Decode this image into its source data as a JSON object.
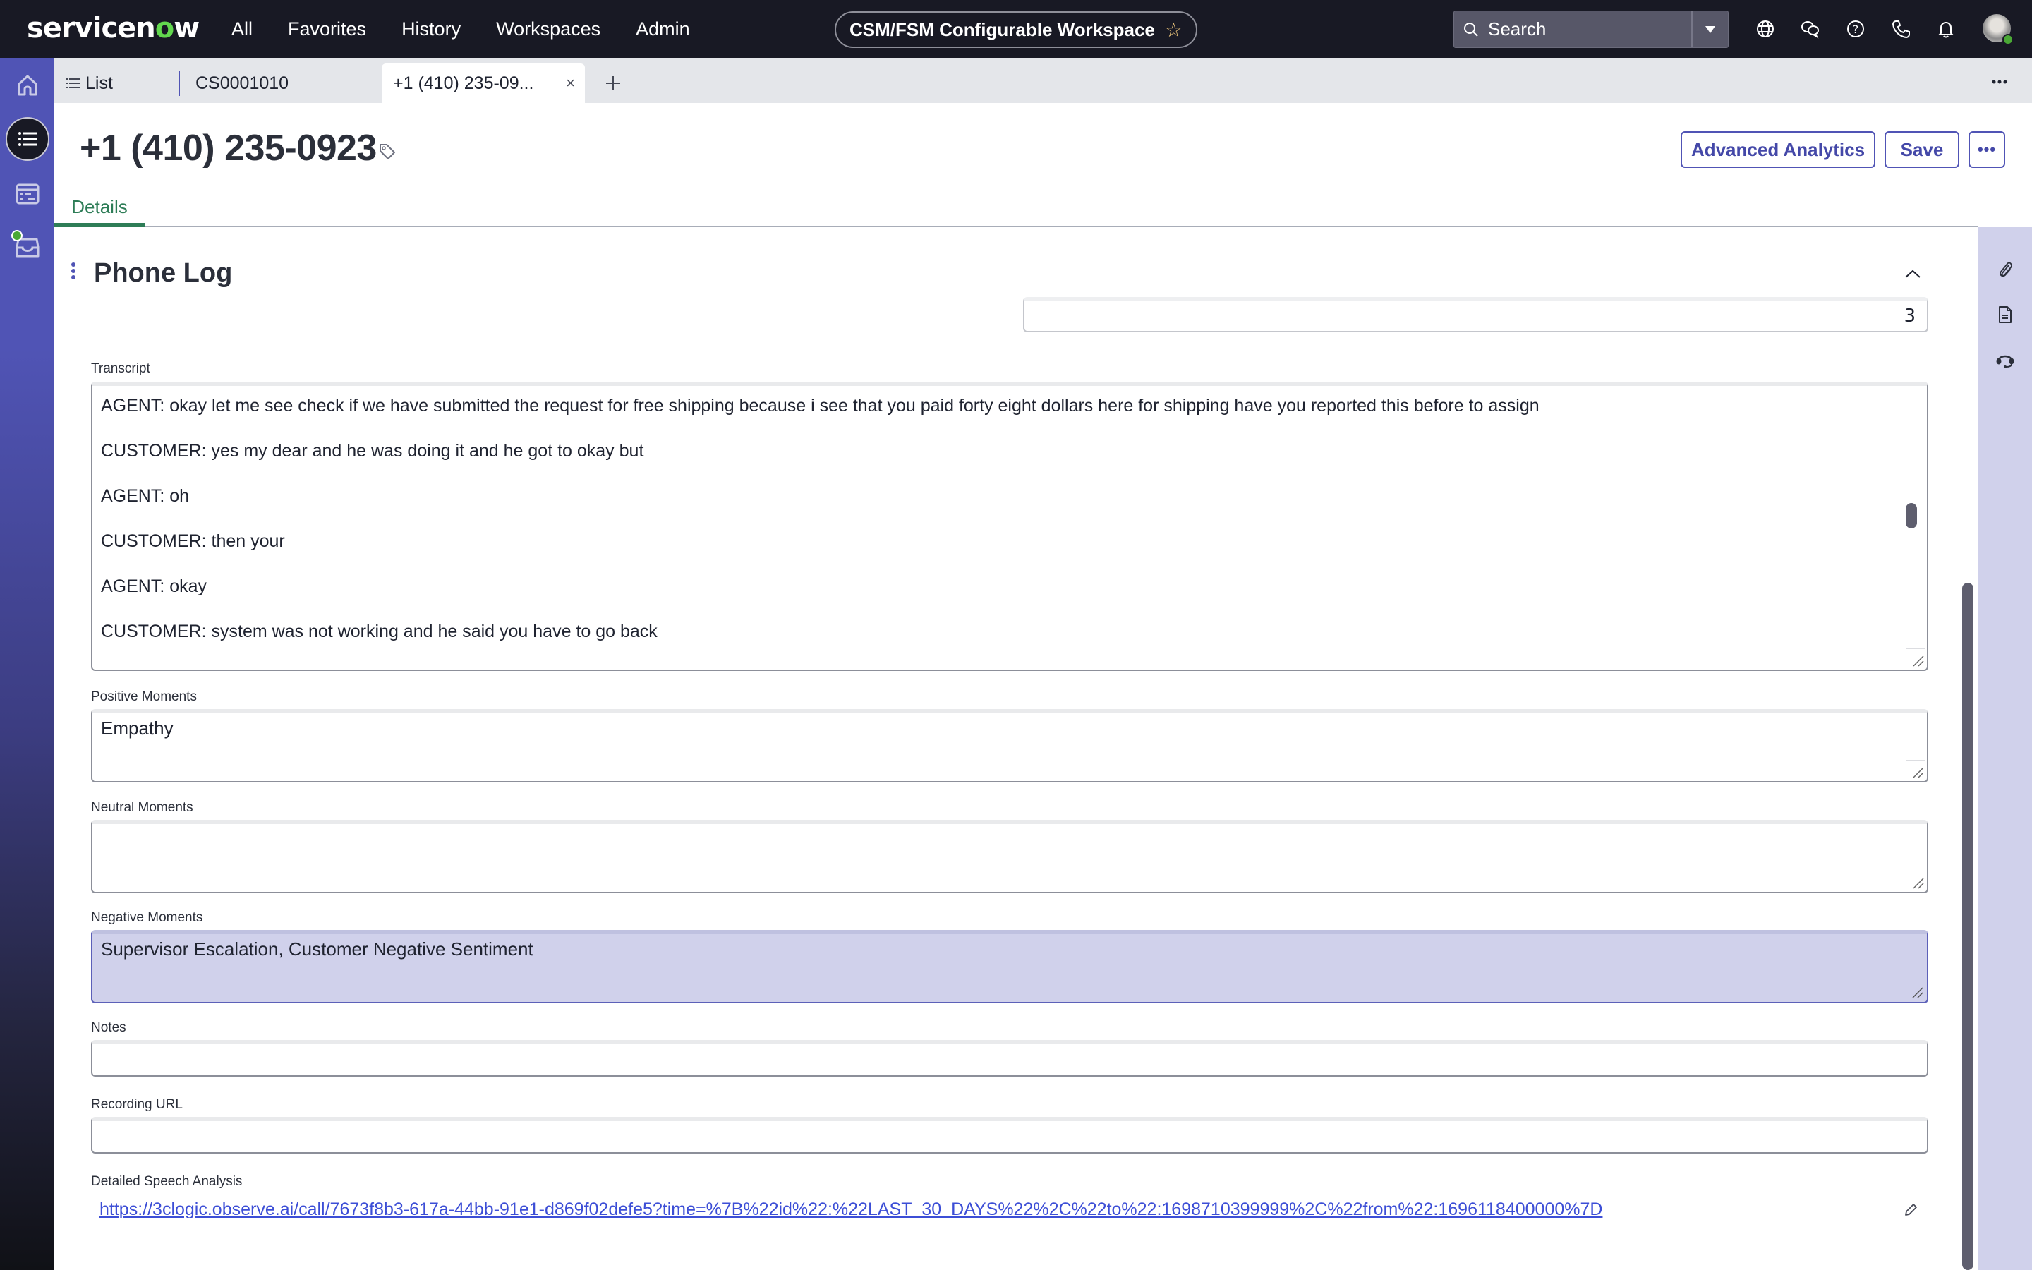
{
  "header": {
    "logo_text_pre": "servicen",
    "logo_text_o": "o",
    "logo_text_post": "w",
    "nav": [
      "All",
      "Favorites",
      "History",
      "Workspaces",
      "Admin"
    ],
    "workspace_name": "CSM/FSM Configurable Workspace",
    "workspace_star": "☆",
    "search_placeholder": "Search",
    "icons": [
      "globe-icon",
      "chat-icon",
      "help-icon",
      "phone-icon",
      "bell-icon"
    ],
    "user_status": "available"
  },
  "left_rail": {
    "items": [
      "home",
      "list",
      "workspace-dashboard",
      "inbox"
    ],
    "active": "list"
  },
  "tabs": {
    "list_label": "List",
    "items": [
      {
        "label": "CS0001010",
        "closable": true
      },
      {
        "label": "+1 (410) 235-09...",
        "closable": true,
        "active": true
      }
    ],
    "close_glyph": "×",
    "add_glyph": "+",
    "more_glyph": "•••"
  },
  "record": {
    "title": "+1 (410) 235-0923",
    "buttons": {
      "analytics": "Advanced Analytics",
      "save": "Save",
      "more": "•••"
    },
    "detail_tab": "Details"
  },
  "section": {
    "title": "Phone Log",
    "count_value": "3",
    "fields": {
      "transcript": {
        "label": "Transcript",
        "lines": [
          "AGENT: okay let me see check if we have submitted the request for free shipping because i see that you paid forty eight dollars here for shipping have you reported this before to assign",
          "CUSTOMER: yes my dear and he was doing it and he got to okay but",
          "AGENT: oh",
          "CUSTOMER: then your",
          "AGENT: okay",
          "CUSTOMER: system was not working and he said you have to go back"
        ]
      },
      "positive_moments": {
        "label": "Positive Moments",
        "value": "Empathy"
      },
      "neutral_moments": {
        "label": "Neutral Moments",
        "value": ""
      },
      "negative_moments": {
        "label": "Negative Moments",
        "value": "Supervisor Escalation, Customer Negative Sentiment"
      },
      "notes": {
        "label": "Notes",
        "value": ""
      },
      "recording_url": {
        "label": "Recording URL",
        "value": ""
      },
      "detailed_speech_analysis": {
        "label": "Detailed Speech Analysis",
        "link": "https://3clogic.observe.ai/call/7673f8b3-617a-44bb-91e1-d869f02defe5?time=%7B%22id%22:%22LAST_30_DAYS%22%2C%22to%22:1698710399999%2C%22from%22:1696118400000%7D"
      }
    }
  },
  "right_rail": {
    "items": [
      "attachment",
      "document",
      "headset"
    ]
  },
  "colors": {
    "header_bg": "#181924",
    "rail_accent": "#5054b5",
    "button_accent": "#4448a8",
    "details_tab": "#2e7d57",
    "highlight_field": "#d0d1eb",
    "link": "#3c4ed6"
  }
}
